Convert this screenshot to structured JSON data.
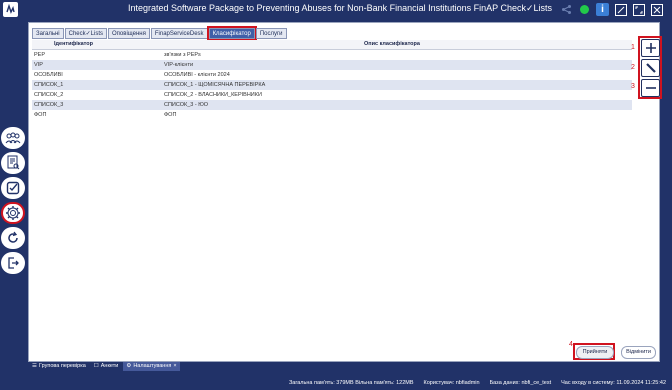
{
  "window": {
    "title": "Integrated Software Package to Preventing Abuses for Non-Bank Financial Institutions FinAP Check✓Lists",
    "info_label": "i"
  },
  "tabs": [
    {
      "label": "Загальні"
    },
    {
      "label": "Check✓Lists"
    },
    {
      "label": "Оповіщення"
    },
    {
      "label": "FinapServiceDesk"
    },
    {
      "label": "Класифікатор"
    },
    {
      "label": "Послуги"
    }
  ],
  "table": {
    "headers": [
      "Ідентифікатор",
      "Опис класифікатора"
    ],
    "rows": [
      {
        "id": "PEP",
        "desc": "зв'язки з PEPs"
      },
      {
        "id": "VIP",
        "desc": "VIP-клієнти"
      },
      {
        "id": "ОСОБЛИВІ",
        "desc": "ОСОБЛИВІ - клієнти 2024"
      },
      {
        "id": "СПИСОК_1",
        "desc": "СПИСОК_1 - ЩОМІСЯЧНА ПЕРЕВІРКА"
      },
      {
        "id": "СПИСОК_2",
        "desc": "СПИСОК_2 - ВЛАСНИКИ_КЕРІВНИКИ"
      },
      {
        "id": "СПИСОК_3",
        "desc": "СПИСОК_3 - ЮО"
      },
      {
        "id": "ФОП",
        "desc": "ФОП"
      }
    ]
  },
  "annotations": [
    "1",
    "2",
    "3",
    "4"
  ],
  "buttons": {
    "apply": "Прийняти",
    "cancel": "Відмінити"
  },
  "bottom_tabs": [
    {
      "label": "Групова перевірка",
      "icon": "list-icon"
    },
    {
      "label": "Анкети",
      "icon": "form-icon"
    },
    {
      "label": "Налаштування",
      "icon": "gear-icon",
      "close": "×"
    }
  ],
  "status": {
    "memory": "Загальна пам'ять: 379МВ Вільна пам'ять: 122МВ",
    "user": "Користувач: nbfiadmin",
    "db": "База даних: nbfi_ce_test",
    "login_time": "Час входу в систему: 11.09.2024 11:25:42"
  },
  "colors": {
    "background": "#213268",
    "accent": "#3f5fa8",
    "highlight": "#d0131f"
  }
}
